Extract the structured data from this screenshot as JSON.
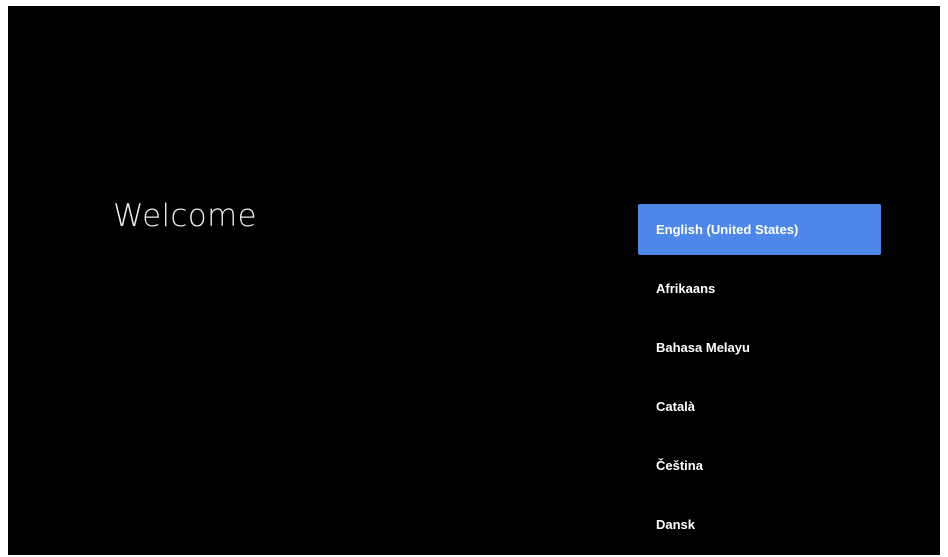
{
  "welcome": {
    "title": "Welcome"
  },
  "languages": {
    "selected_index": 0,
    "selected_color": "#4f86ea",
    "items": [
      {
        "label": "English (United States)"
      },
      {
        "label": "Afrikaans"
      },
      {
        "label": "Bahasa Melayu"
      },
      {
        "label": "Català"
      },
      {
        "label": "Čeština"
      },
      {
        "label": "Dansk"
      }
    ]
  }
}
